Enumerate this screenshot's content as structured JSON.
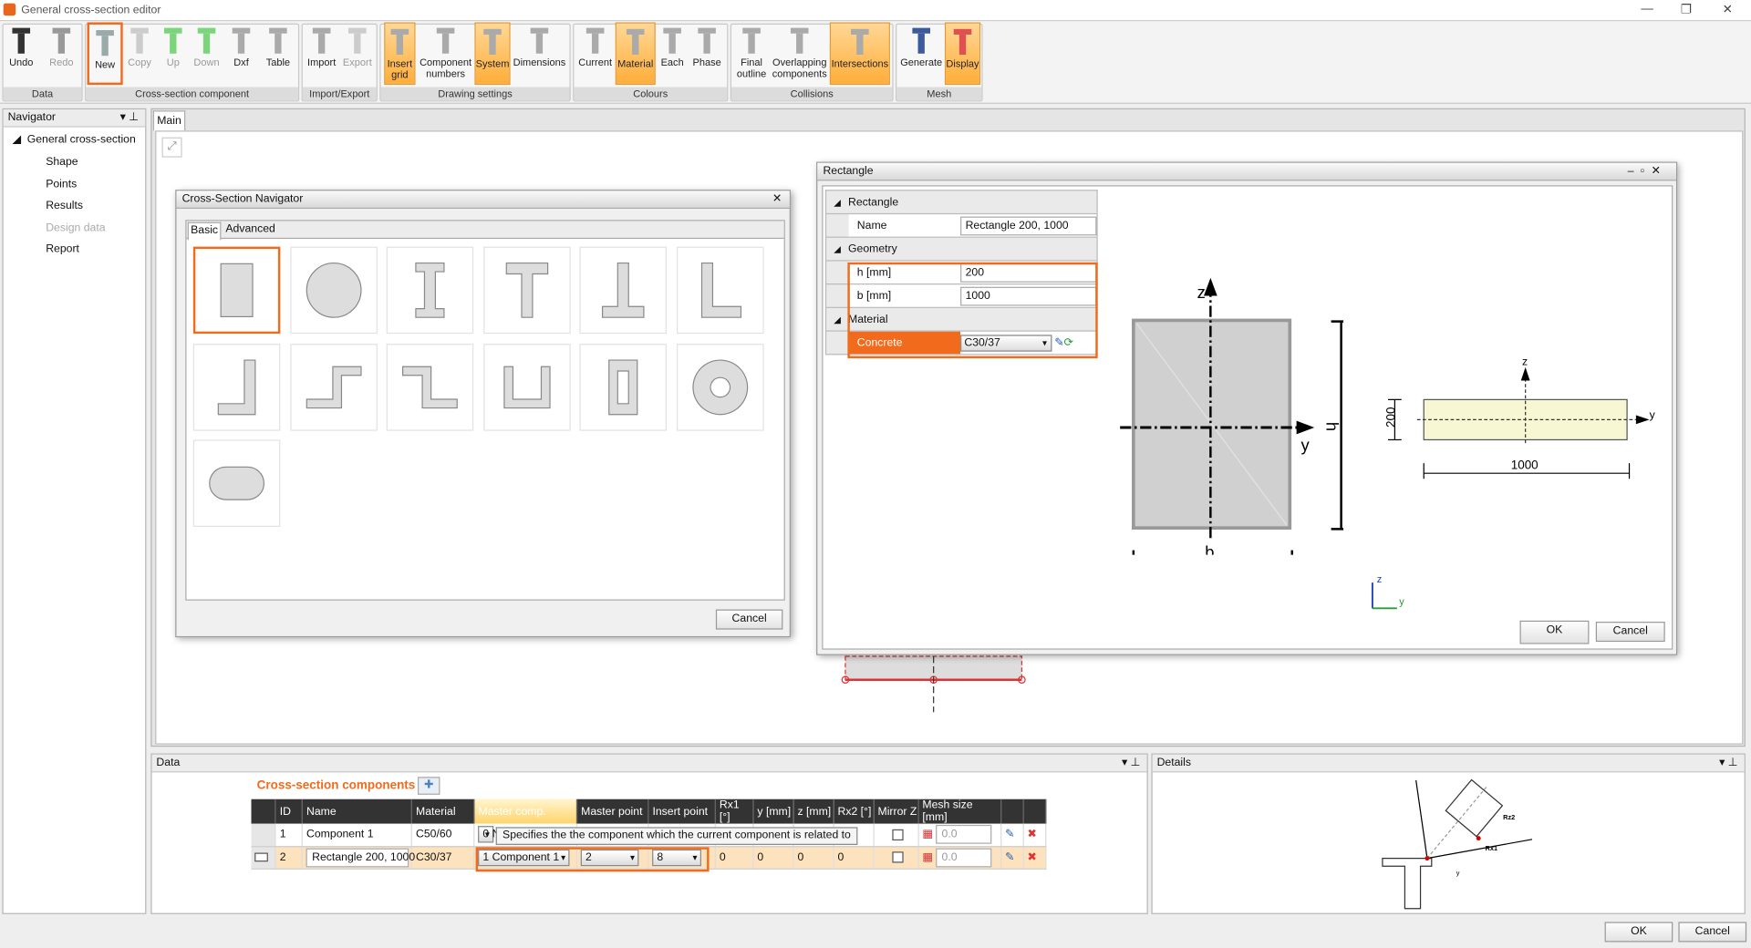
{
  "window": {
    "title": "General cross-section editor",
    "min": "—",
    "restore": "❐",
    "close": "✕"
  },
  "ribbon": {
    "groups": [
      {
        "label": "Data"
      },
      {
        "label": "Cross-section component"
      },
      {
        "label": "Import/Export"
      },
      {
        "label": "Drawing settings"
      },
      {
        "label": "Colours"
      },
      {
        "label": "Collisions"
      },
      {
        "label": "Mesh"
      }
    ],
    "buttons": [
      {
        "label": "Undo",
        "icon": "undo-icon",
        "state": "enabled"
      },
      {
        "label": "Redo",
        "icon": "redo-icon",
        "state": "disabled"
      },
      {
        "label": "New",
        "icon": "new-component-icon",
        "state": "highlighted"
      },
      {
        "label": "Copy",
        "icon": "copy-icon",
        "state": "disabled"
      },
      {
        "label": "Up",
        "icon": "arrow-up-icon",
        "state": "disabled"
      },
      {
        "label": "Down",
        "icon": "arrow-down-icon",
        "state": "disabled"
      },
      {
        "label": "Dxf",
        "icon": "dxf-icon",
        "state": "enabled"
      },
      {
        "label": "Table",
        "icon": "table-icon",
        "state": "enabled"
      },
      {
        "label": "Import",
        "icon": "import-icon",
        "state": "enabled"
      },
      {
        "label": "Export",
        "icon": "export-icon",
        "state": "disabled"
      },
      {
        "label": "Insert grid",
        "icon": "insert-grid-icon",
        "state": "active"
      },
      {
        "label": "Component numbers",
        "icon": "component-numbers-icon",
        "state": "enabled"
      },
      {
        "label": "System",
        "icon": "system-axes-icon",
        "state": "active"
      },
      {
        "label": "Dimensions",
        "icon": "dimensions-icon",
        "state": "enabled"
      },
      {
        "label": "Current",
        "icon": "colour-current-icon",
        "state": "enabled"
      },
      {
        "label": "Material",
        "icon": "colour-material-icon",
        "state": "active"
      },
      {
        "label": "Each",
        "icon": "colour-each-icon",
        "state": "enabled"
      },
      {
        "label": "Phase",
        "icon": "colour-phase-icon",
        "state": "enabled"
      },
      {
        "label": "Final outline",
        "icon": "final-outline-icon",
        "state": "enabled"
      },
      {
        "label": "Overlapping components",
        "icon": "overlapping-icon",
        "state": "enabled"
      },
      {
        "label": "Intersections",
        "icon": "intersections-icon",
        "state": "active"
      },
      {
        "label": "Generate",
        "icon": "gear-icon",
        "state": "enabled"
      },
      {
        "label": "Display",
        "icon": "mesh-display-icon",
        "state": "active"
      }
    ]
  },
  "navigator": {
    "title": "Navigator",
    "root": "General cross-section",
    "items": [
      {
        "label": "Shape",
        "enabled": true
      },
      {
        "label": "Points",
        "enabled": true
      },
      {
        "label": "Results",
        "enabled": true
      },
      {
        "label": "Design data",
        "enabled": false
      },
      {
        "label": "Report",
        "enabled": true
      }
    ]
  },
  "main": {
    "tab": "Main"
  },
  "cs_navigator": {
    "title": "Cross-Section Navigator",
    "tabs": [
      "Basic",
      "Advanced"
    ],
    "active_tab": "Basic",
    "shapes": [
      "rectangle",
      "circle",
      "i-section",
      "t-section",
      "inverted-t",
      "l-section",
      "angle-right",
      "z-section",
      "reverse-step",
      "u-section",
      "hollow-rectangle",
      "hollow-circle",
      "oval"
    ],
    "cancel": "Cancel"
  },
  "rect_dialog": {
    "title": "Rectangle",
    "sections": {
      "rectangle": "Rectangle",
      "geometry": "Geometry",
      "material": "Material"
    },
    "name_label": "Name",
    "name_value": "Rectangle 200, 1000",
    "h_label": "h [mm]",
    "h_value": "200",
    "b_label": "b [mm]",
    "b_value": "1000",
    "material_label": "Concrete",
    "material_value": "C30/37",
    "drawing": {
      "z": "z",
      "y": "y",
      "h": "h",
      "b": "b",
      "dim_h": "200",
      "dim_b": "1000",
      "axis_z": "z",
      "axis_y": "y"
    },
    "ok": "OK",
    "cancel": "Cancel"
  },
  "data_panel": {
    "title": "Data",
    "section_title": "Cross-section components",
    "columns": [
      "ID",
      "Name",
      "Material",
      "Master comp.",
      "Master point",
      "Insert point",
      "Rx1 [°]",
      "y [mm]",
      "z [mm]",
      "Rx2 [°]",
      "Mirror Z",
      "Mesh size [mm]"
    ],
    "rows": [
      {
        "id": "1",
        "name": "Component 1",
        "material": "C50/60",
        "master": "0 N",
        "master_point": "",
        "insert_point": "",
        "rx1": "",
        "y": "",
        "z": "",
        "rx2": "",
        "mesh": "0.0"
      },
      {
        "id": "2",
        "name": "Rectangle 200, 1000",
        "material": "C30/37",
        "master": "1 Component 1",
        "master_point": "2",
        "insert_point": "8",
        "rx1": "0",
        "y": "0",
        "z": "0",
        "rx2": "0",
        "mesh": "0.0"
      }
    ],
    "tooltip": "Specifies the the component which the current component is related to"
  },
  "details": {
    "title": "Details",
    "labels": {
      "rz": "Rz2",
      "rx": "Rx1",
      "y": "y",
      "z": "z"
    }
  },
  "footer": {
    "ok": "OK",
    "cancel": "Cancel"
  },
  "colors": {
    "accent": "#f26b1d",
    "active": "#ffb347",
    "concrete": "#f7f7d4"
  }
}
